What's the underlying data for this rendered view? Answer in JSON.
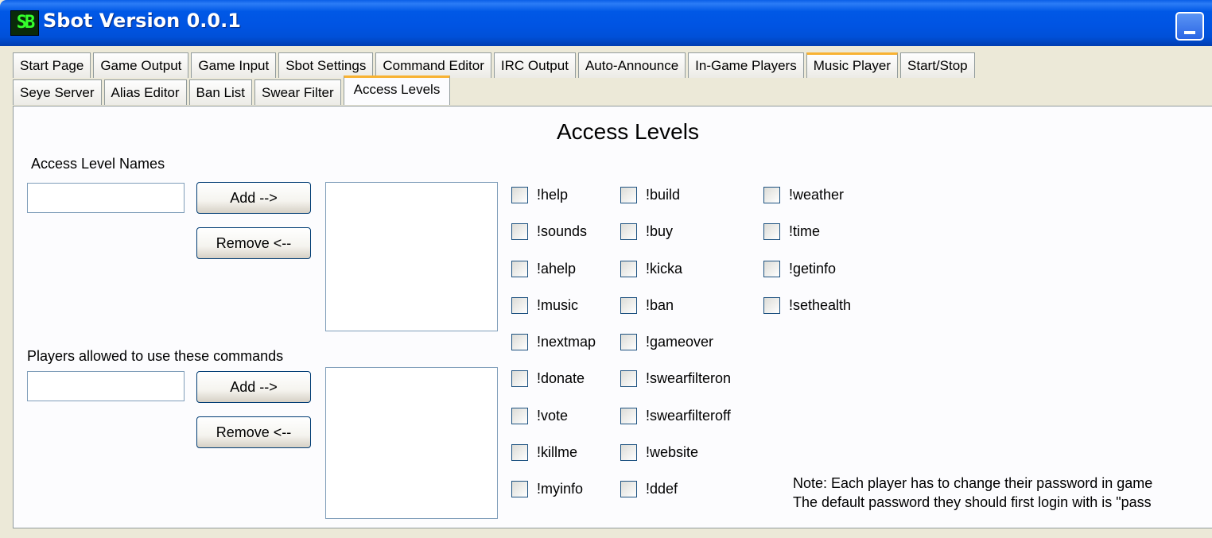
{
  "window": {
    "title": "Sbot Version 0.0.1",
    "icon": "SB"
  },
  "tabs": {
    "row1": [
      "Start Page",
      "Game Output",
      "Game Input",
      "Sbot Settings",
      "Command Editor",
      "IRC Output",
      "Auto-Announce",
      "In-Game Players",
      "Music Player",
      "Start/Stop"
    ],
    "row2": [
      "Seye Server",
      "Alias Editor",
      "Ban List",
      "Swear Filter",
      "Access Levels"
    ],
    "active": "Access Levels"
  },
  "page": {
    "heading": "Access Levels",
    "access_level_names": {
      "label": "Access Level Names",
      "input_value": "",
      "add_label": "Add -->",
      "remove_label": "Remove <--"
    },
    "players": {
      "label": "Players allowed to use these commands",
      "input_value": "",
      "add_label": "Add -->",
      "remove_label": "Remove <--"
    }
  },
  "commands": {
    "col1": [
      "!help",
      "!sounds",
      "!ahelp",
      "!music",
      "!nextmap",
      "!donate",
      "!vote",
      "!killme",
      "!myinfo"
    ],
    "col2": [
      "!build",
      "!buy",
      "!kicka",
      "!ban",
      "!gameover",
      "!swearfilteron",
      "!swearfilteroff",
      "!website",
      "!ddef"
    ],
    "col3": [
      "!weather",
      "!time",
      "!getinfo",
      "!sethealth"
    ]
  },
  "note": {
    "line1": "Note: Each player has to change their password in game",
    "line2": "The default password they should first login with is \"pass"
  }
}
